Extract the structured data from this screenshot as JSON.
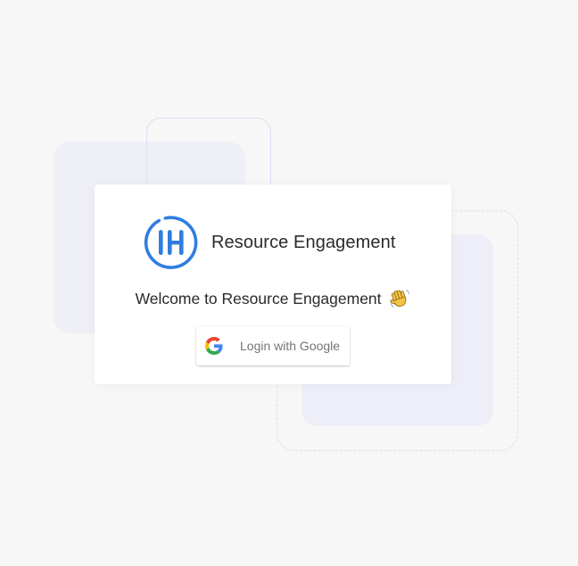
{
  "app": {
    "name": "Resource Engagement",
    "logo_icon": "ih-logo-icon",
    "brand_color": "#2f7de1"
  },
  "login": {
    "welcome_text": "Welcome to Resource Engagement",
    "welcome_emoji_icon": "waving-hand-icon",
    "google_button_label": "Login with Google",
    "google_icon": "google-g-icon"
  },
  "colors": {
    "background": "#f7f7f7",
    "card": "#ffffff",
    "decor_fill": "#efeff7",
    "decor_outline": "#dcdff3"
  }
}
